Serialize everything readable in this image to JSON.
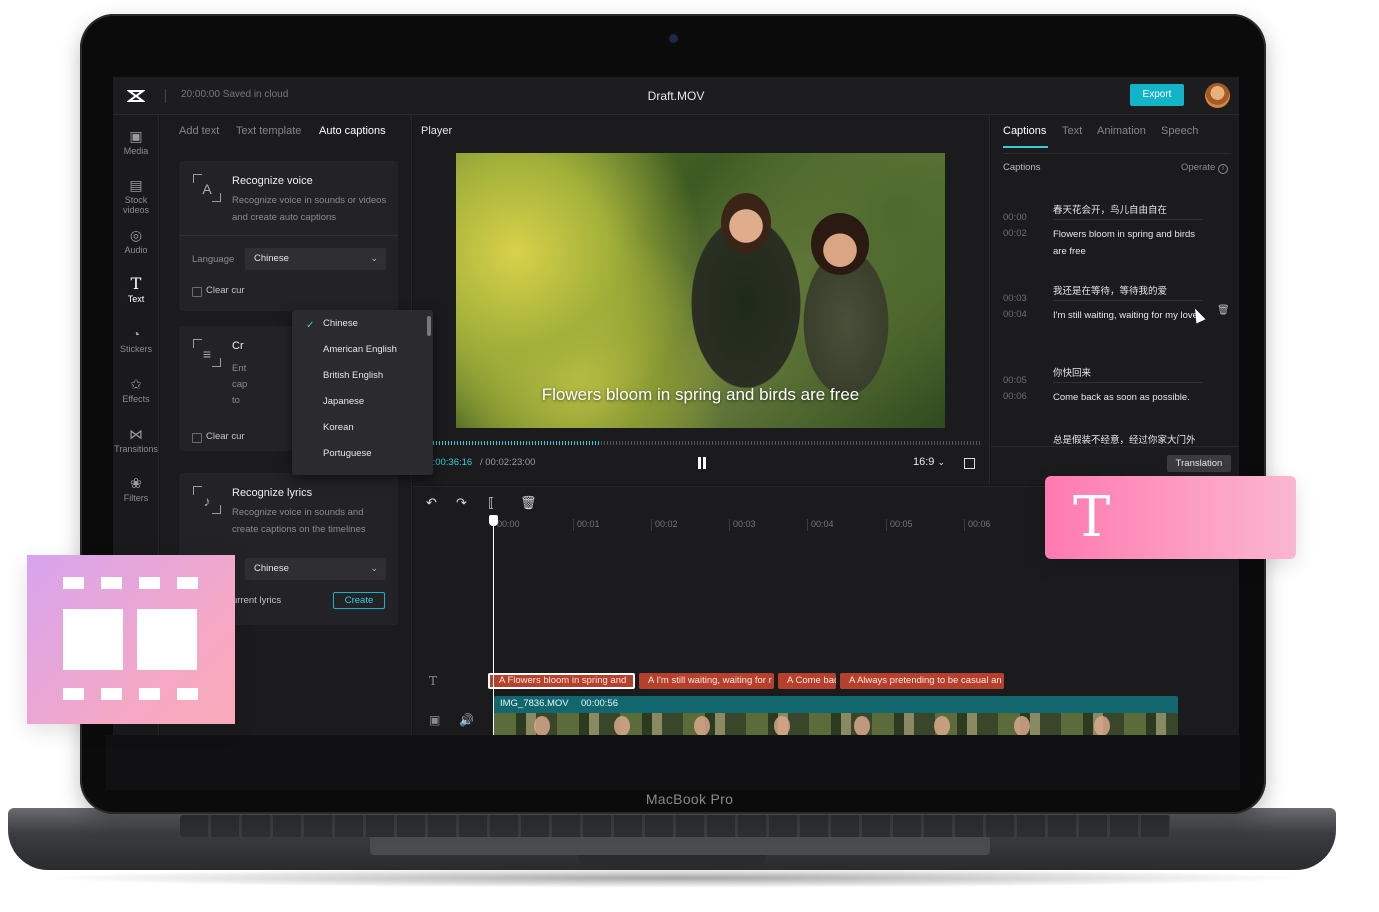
{
  "app": {
    "saved_status": "20:00:00 Saved in cloud",
    "file_name": "Draft.MOV",
    "export_label": "Export",
    "device_label": "MacBook Pro",
    "accent": "#12b5c7"
  },
  "sidebar": {
    "items": [
      {
        "label": "Media",
        "icon": "media-icon"
      },
      {
        "label": "Stock videos",
        "icon": "stock-videos-icon"
      },
      {
        "label": "Audio",
        "icon": "audio-icon"
      },
      {
        "label": "Text",
        "icon": "text-icon",
        "active": true
      },
      {
        "label": "Stickers",
        "icon": "stickers-icon"
      },
      {
        "label": "Effects",
        "icon": "effects-icon"
      },
      {
        "label": "Transitions",
        "icon": "transitions-icon"
      },
      {
        "label": "Filters",
        "icon": "filters-icon"
      }
    ]
  },
  "left_panel": {
    "tabs": [
      "Add text",
      "Text template",
      "Auto captions"
    ],
    "active_tab": "Auto captions",
    "recognize_voice": {
      "title": "Recognize voice",
      "description": "Recognize voice in sounds or videos and create auto captions",
      "language_label": "Language",
      "language_value": "Chinese",
      "clear_label": "Clear cur"
    },
    "create_card": {
      "title": "Cr",
      "desc_lines": [
        "Ent",
        "cap",
        "to"
      ],
      "clear_label": "Clear cur"
    },
    "recognize_lyrics": {
      "title": "Recognize lyrics",
      "description": "Recognize voice in sounds and create captions on the timelines",
      "language_value": "Chinese",
      "clear_label": "urrent lyrics",
      "create_label": "Create"
    },
    "language_options": [
      "Chinese",
      "American English",
      "British English",
      "Japanese",
      "Korean",
      "Portuguese"
    ],
    "selected_language": "Chinese"
  },
  "player": {
    "title": "Player",
    "subtitle": "Flowers bloom in spring and birds are free",
    "current_time": "00:00:36:16",
    "total_time": "/ 00:02:23:00",
    "aspect_ratio": "16:9",
    "progress": 0.32
  },
  "right_panel": {
    "tabs": [
      "Captions",
      "Text",
      "Animation",
      "Speech"
    ],
    "active_tab": "Captions",
    "header": "Captions",
    "operate_label": "Operate",
    "captions": [
      {
        "start": "00:00",
        "end": "00:02",
        "zh": "春天花会开，鸟儿自由自在",
        "en": "Flowers bloom in spring and birds are free"
      },
      {
        "start": "00:03",
        "end": "00:04",
        "zh": "我还是在等待，等待我的爱",
        "en": "I'm still waiting, waiting for my love"
      },
      {
        "start": "00:05",
        "end": "00:06",
        "zh": "你快回来",
        "en": "Come back as soon as possible."
      },
      {
        "zh": "总是假装不经意，经过你家大门外"
      }
    ],
    "translation_label": "Translation"
  },
  "timeline": {
    "ruler": [
      "00:00",
      "00:01",
      "00:02",
      "00:03",
      "00:04",
      "00:05",
      "00:06"
    ],
    "caption_clips": [
      "Flowers bloom in spring and",
      "I'm still waiting, waiting for r",
      "Come bac",
      "Always pretending to be casual an"
    ],
    "video_clip": {
      "name": "IMG_7836.MOV",
      "duration": "00:00:56"
    }
  },
  "decor": {
    "text_card_letter": "T"
  }
}
